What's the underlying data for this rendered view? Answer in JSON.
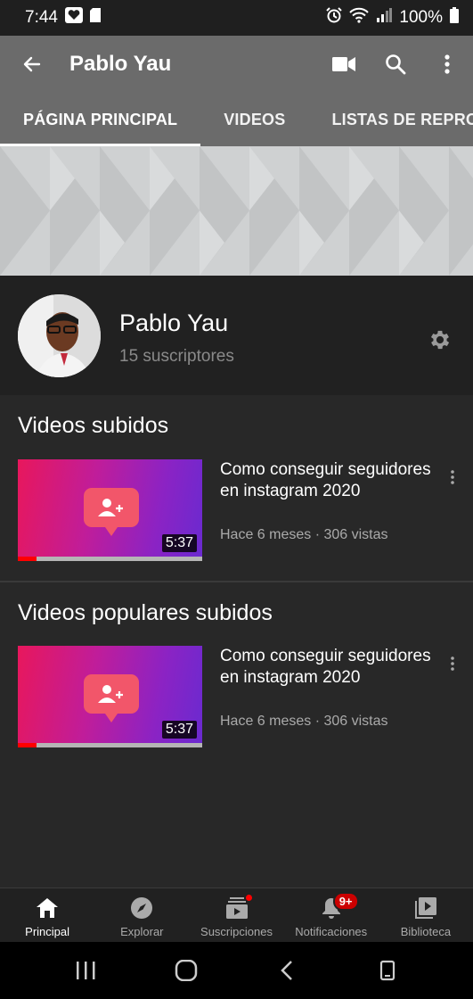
{
  "status_bar": {
    "time": "7:44",
    "battery": "100%"
  },
  "app_bar": {
    "title": "Pablo Yau",
    "icons": [
      "back-arrow-icon",
      "camera-icon",
      "search-icon",
      "more-vert-icon"
    ]
  },
  "tabs": [
    {
      "label": "PÁGINA PRINCIPAL",
      "active": true
    },
    {
      "label": "VIDEOS",
      "active": false
    },
    {
      "label": "LISTAS DE REPRO",
      "active": false
    }
  ],
  "channel": {
    "name": "Pablo Yau",
    "subscribers": "15 suscriptores"
  },
  "sections": [
    {
      "title": "Videos subidos",
      "video": {
        "title": "Como conseguir seguidores en instagram 2020",
        "meta": "Hace 6 meses · 306 vistas",
        "duration": "5:37",
        "progress": 0.1
      }
    },
    {
      "title": "Videos populares subidos",
      "video": {
        "title": "Como conseguir seguidores en instagram 2020",
        "meta": "Hace 6 meses · 306 vistas",
        "duration": "5:37",
        "progress": 0.1
      }
    }
  ],
  "bottom_nav": [
    {
      "label": "Principal",
      "icon": "home-icon",
      "active": true
    },
    {
      "label": "Explorar",
      "icon": "compass-icon",
      "active": false
    },
    {
      "label": "Suscripciones",
      "icon": "subscriptions-icon",
      "active": false
    },
    {
      "label": "Notificaciones",
      "icon": "bell-icon",
      "active": false,
      "badge": "9+"
    },
    {
      "label": "Biblioteca",
      "icon": "library-icon",
      "active": false
    }
  ],
  "colors": {
    "accent": "#ff0000",
    "app_bar": "#6b6b6b",
    "background": "#282828"
  }
}
